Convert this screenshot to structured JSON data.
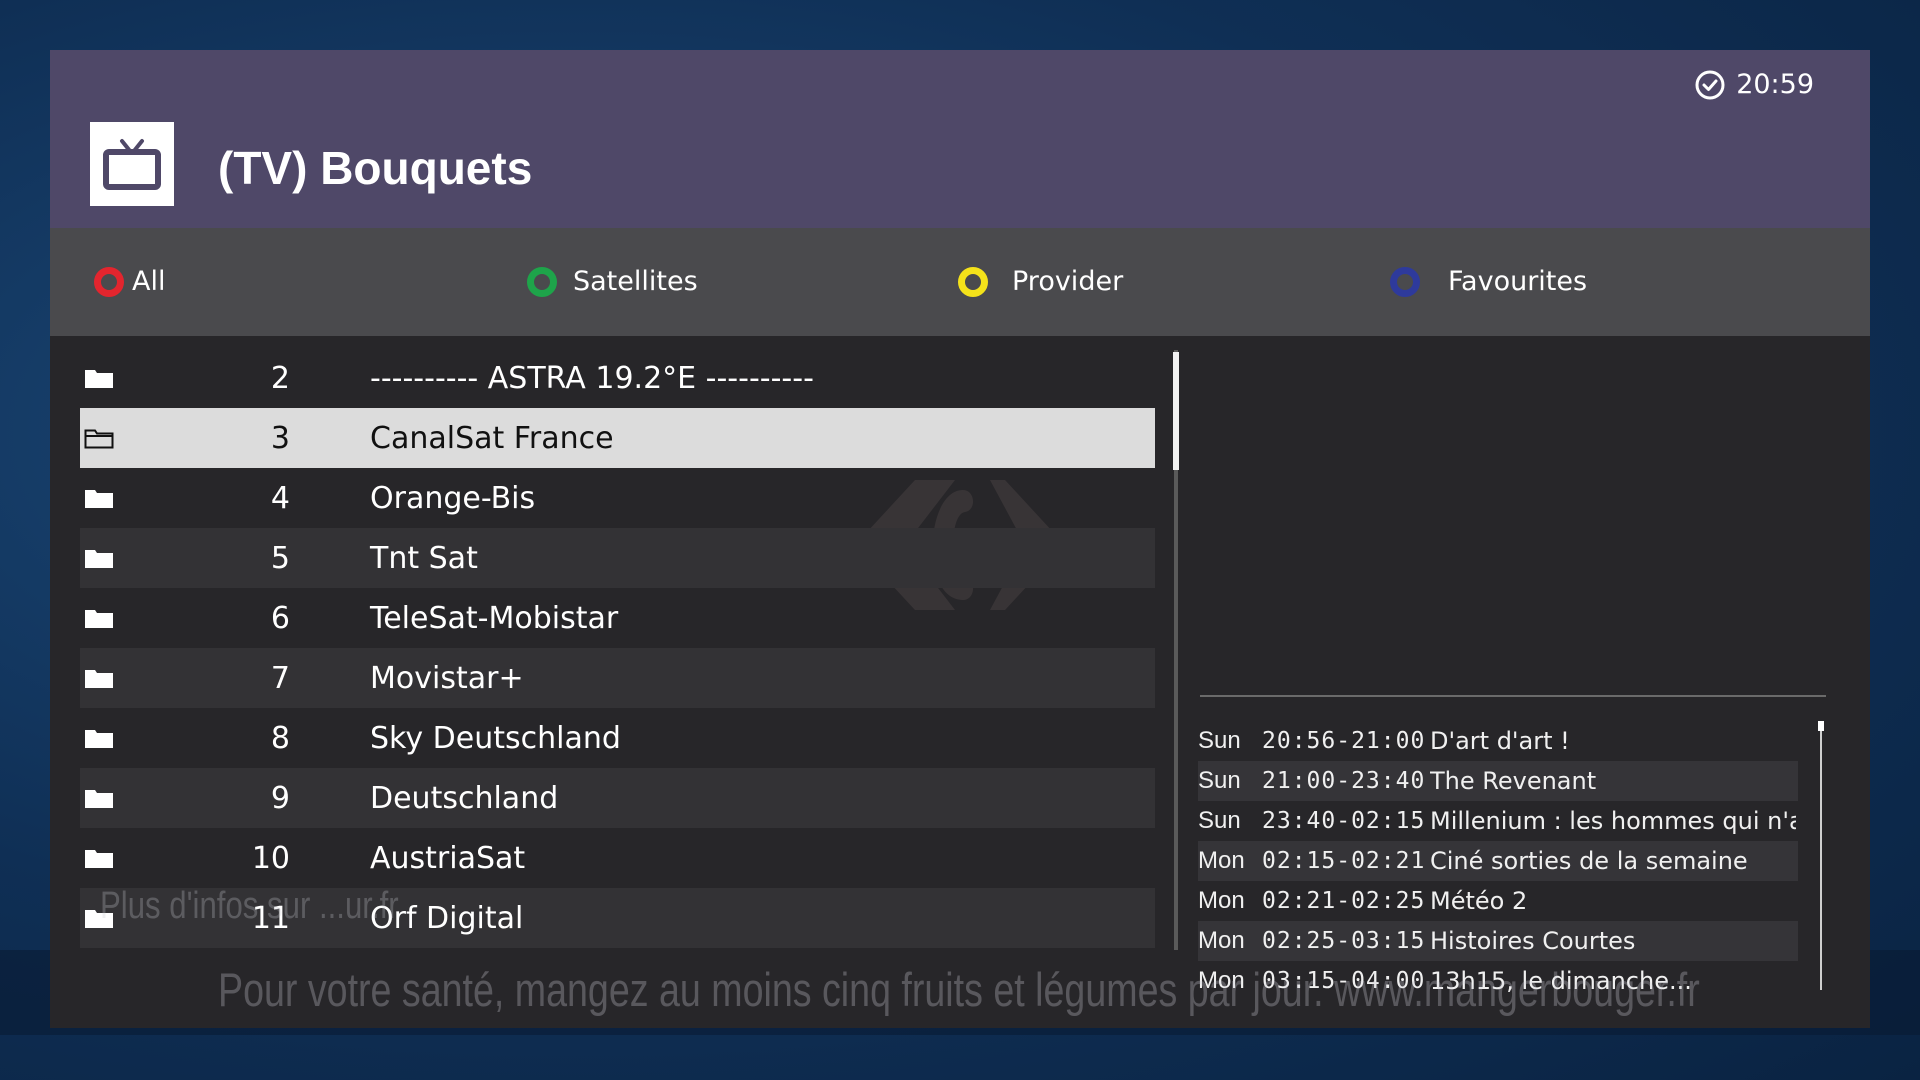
{
  "header": {
    "title": "(TV) Bouquets",
    "clock": "20:59",
    "icon": "tv-icon"
  },
  "keys": [
    {
      "label": "All",
      "color": "#e3252e"
    },
    {
      "label": "Satellites",
      "color": "#1ea44a"
    },
    {
      "label": "Provider",
      "color": "#f4e21a"
    },
    {
      "label": "Favourites",
      "color": "#2e3a9c"
    }
  ],
  "bouquets": [
    {
      "num": "2",
      "name": "---------- ASTRA 19.2°E ----------"
    },
    {
      "num": "3",
      "name": "CanalSat France"
    },
    {
      "num": "4",
      "name": "Orange-Bis"
    },
    {
      "num": "5",
      "name": "Tnt Sat"
    },
    {
      "num": "6",
      "name": "TeleSat-Mobistar"
    },
    {
      "num": "7",
      "name": "Movistar+"
    },
    {
      "num": "8",
      "name": "Sky Deutschland"
    },
    {
      "num": "9",
      "name": "Deutschland"
    },
    {
      "num": "10",
      "name": "AustriaSat"
    },
    {
      "num": "11",
      "name": "Orf Digital"
    }
  ],
  "selected_index": 1,
  "epg": [
    {
      "day": "Sun",
      "time": "20:56-21:00",
      "title": "D'art d'art !"
    },
    {
      "day": "Sun",
      "time": "21:00-23:40",
      "title": "The Revenant"
    },
    {
      "day": "Sun",
      "time": "23:40-02:15",
      "title": "Millenium : les hommes qui n'aimaient pas les femmes"
    },
    {
      "day": "Mon",
      "time": "02:15-02:21",
      "title": "Ciné sorties de la semaine"
    },
    {
      "day": "Mon",
      "time": "02:21-02:25",
      "title": "Météo 2"
    },
    {
      "day": "Mon",
      "time": "02:25-03:15",
      "title": "Histoires Courtes"
    },
    {
      "day": "Mon",
      "time": "03:15-04:00",
      "title": "13h15, le dimanche..."
    }
  ],
  "overlay": {
    "info": "Plus d'infos sur ...ur.fr",
    "health": "Pour votre santé, mangez au moins cinq fruits et légumes par jour. www.mangerbouger.fr"
  },
  "colors": {
    "header_bg": "#4f4868",
    "keybar_bg": "#4a4a4d",
    "list_bg": "#272629",
    "selected_bg": "#dcdcdc"
  }
}
